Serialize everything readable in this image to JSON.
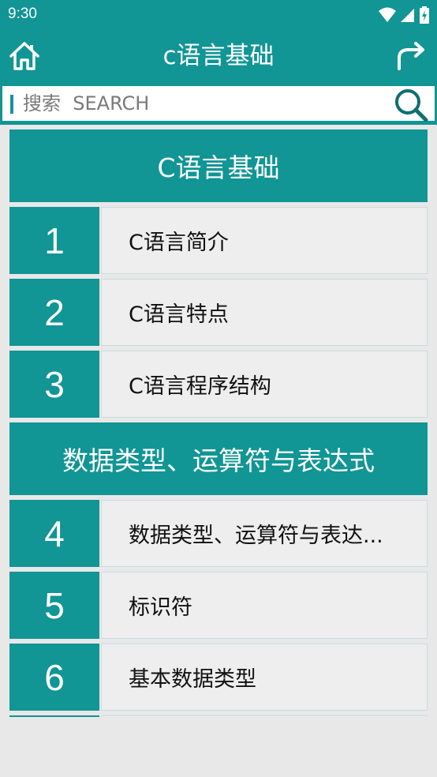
{
  "status_bar": {
    "time": "9:30"
  },
  "app_bar": {
    "title": "c语言基础"
  },
  "search": {
    "placeholder": "搜索  SEARCH"
  },
  "sections": [
    {
      "header": "C语言基础",
      "items": [
        {
          "num": "1",
          "title": "C语言简介"
        },
        {
          "num": "2",
          "title": "C语言特点"
        },
        {
          "num": "3",
          "title": "C语言程序结构"
        }
      ]
    },
    {
      "header": "数据类型、运算符与表达式",
      "items": [
        {
          "num": "4",
          "title": "数据类型、运算符与表达..."
        },
        {
          "num": "5",
          "title": "标识符"
        },
        {
          "num": "6",
          "title": "基本数据类型"
        }
      ]
    }
  ],
  "colors": {
    "accent": "#119595",
    "row_bg": "#eeeeee",
    "page_bg": "#e8e8e8"
  }
}
